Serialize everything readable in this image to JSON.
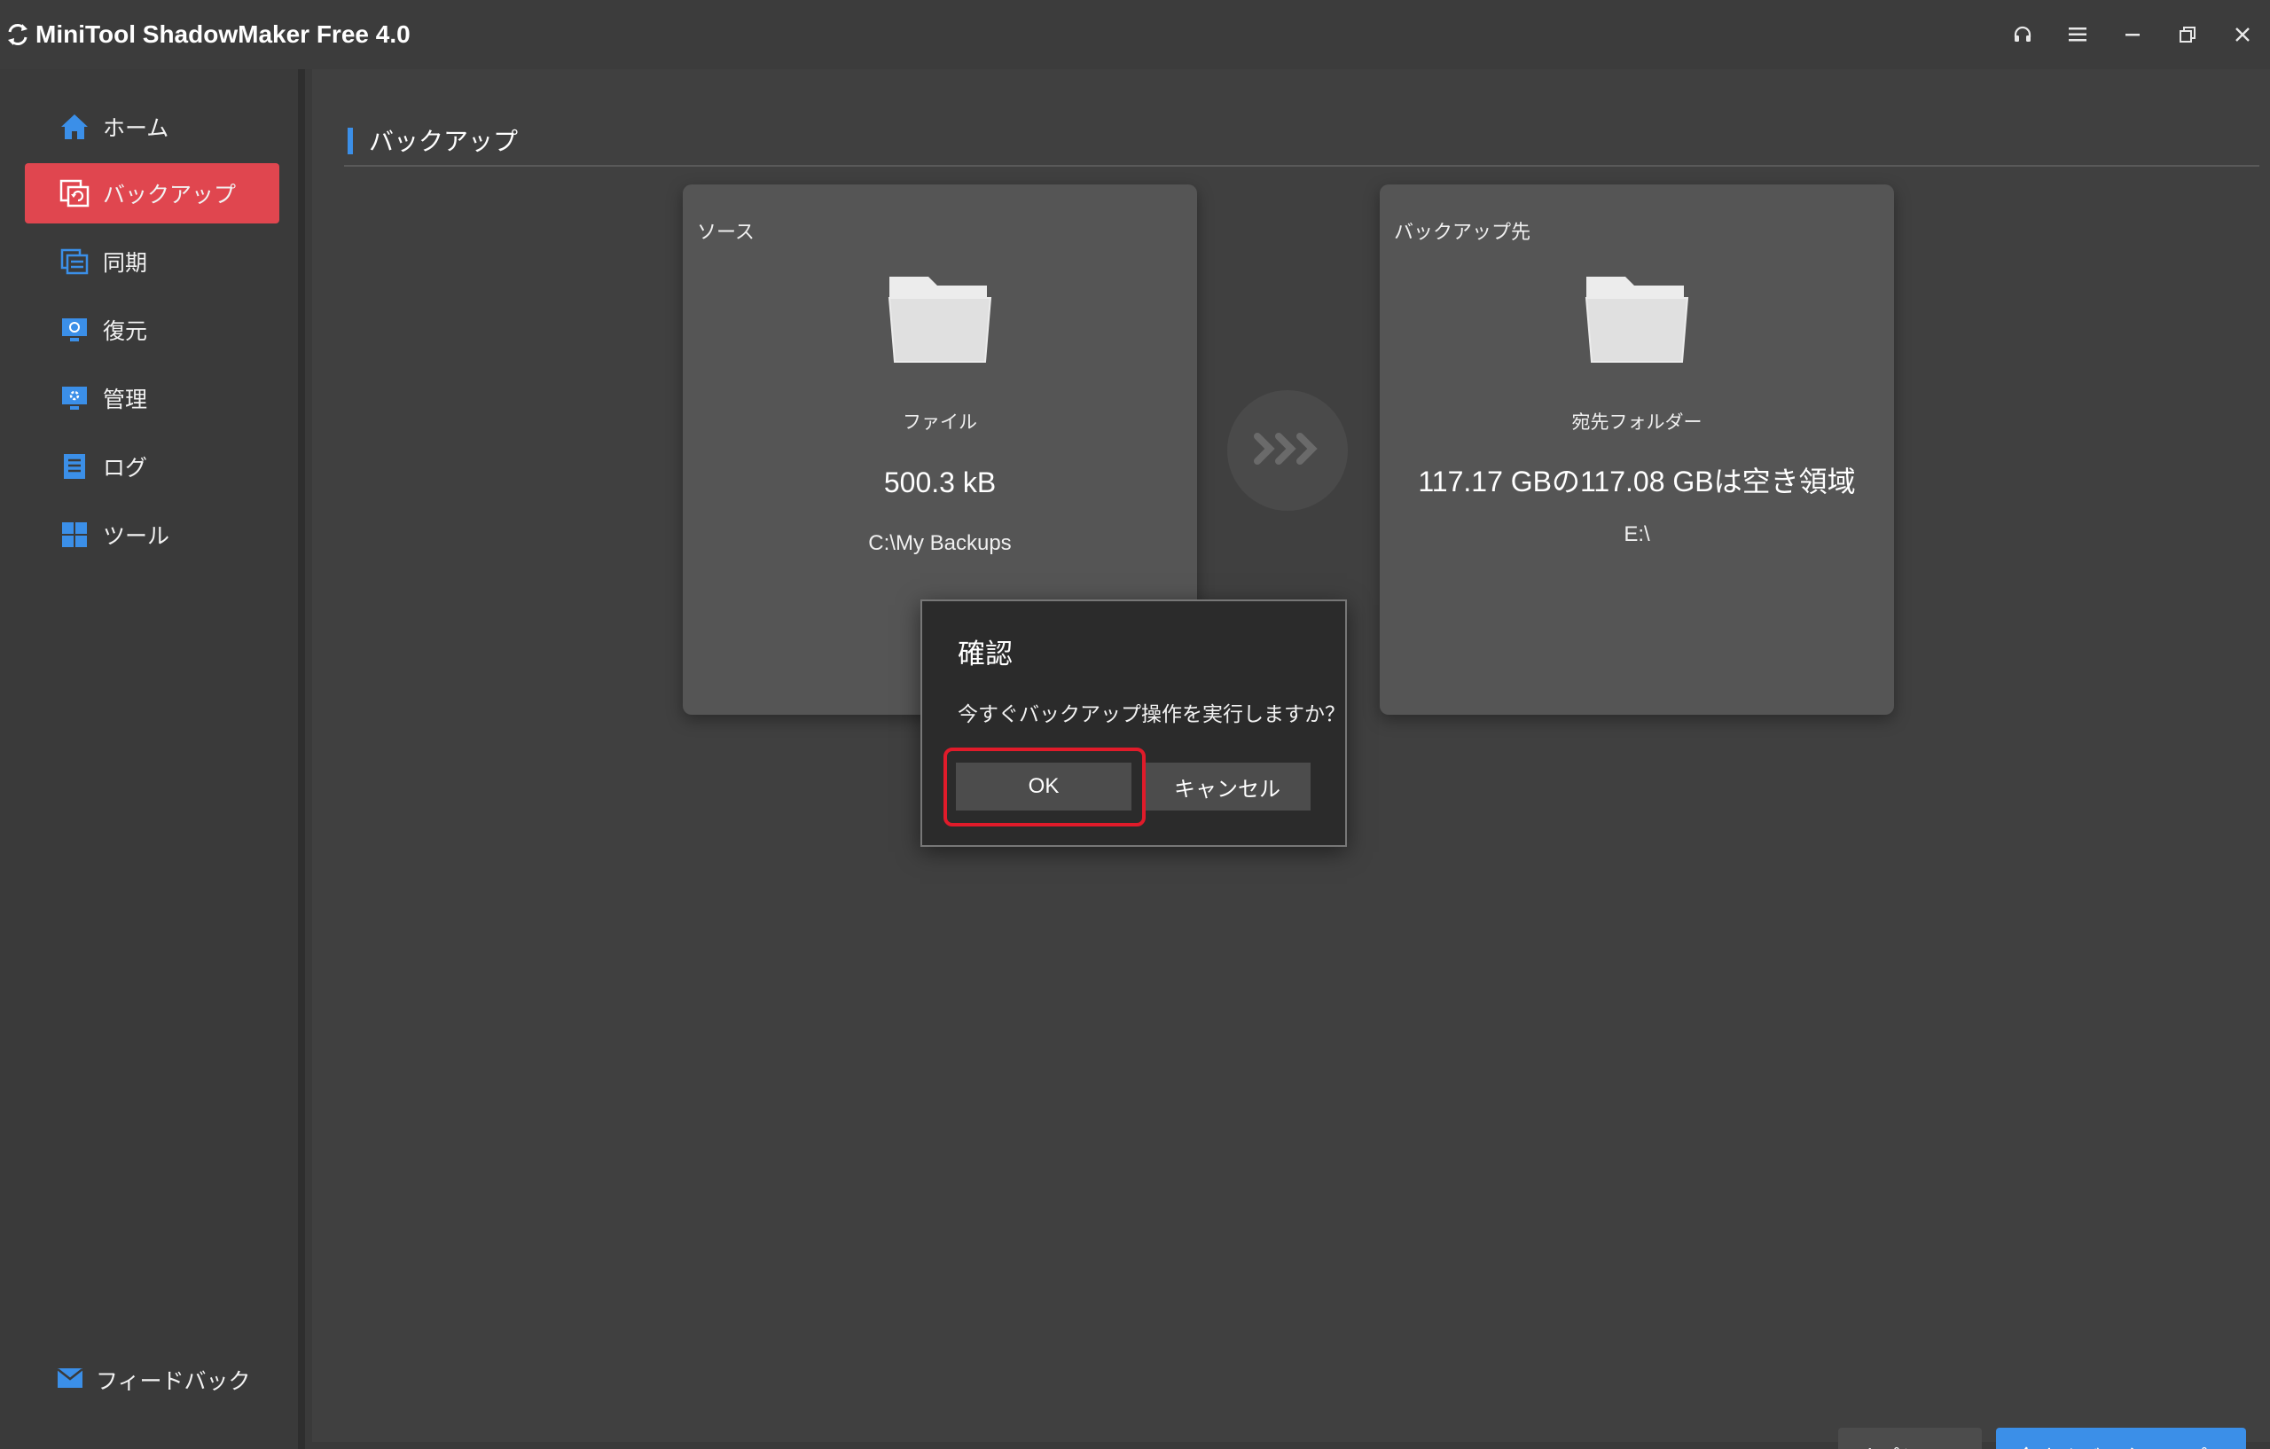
{
  "window": {
    "title": "MiniTool ShadowMaker Free 4.0",
    "controls": [
      "headset-icon",
      "menu-icon",
      "minimize-icon",
      "restore-icon",
      "close-icon"
    ]
  },
  "sidebar": {
    "items": [
      {
        "label": "ホーム",
        "icon": "home-icon",
        "active": false
      },
      {
        "label": "バックアップ",
        "icon": "backup-icon",
        "active": true
      },
      {
        "label": "同期",
        "icon": "sync-icon",
        "active": false
      },
      {
        "label": "復元",
        "icon": "restore-icon",
        "active": false
      },
      {
        "label": "管理",
        "icon": "manage-icon",
        "active": false
      },
      {
        "label": "ログ",
        "icon": "log-icon",
        "active": false
      },
      {
        "label": "ツール",
        "icon": "tools-icon",
        "active": false
      }
    ],
    "feedback": {
      "label": "フィードバック",
      "icon": "mail-icon"
    }
  },
  "main": {
    "section_title": "バックアップ",
    "source": {
      "label": "ソース",
      "type": "ファイル",
      "size": "500.3 kB",
      "path": "C:\\My Backups"
    },
    "destination": {
      "label": "バックアップ先",
      "type": "宛先フォルダー",
      "size": "117.17 GBの117.08 GBは空き領域",
      "path": "E:\\"
    }
  },
  "dialog": {
    "title": "確認",
    "message": "今すぐバックアップ操作を実行しますか？",
    "ok_label": "OK",
    "cancel_label": "キャンセル"
  },
  "footer": {
    "options_label": "オプション",
    "backup_now_label": "今すぐバックアップ",
    "dropdown_glyph": "▼"
  },
  "colors": {
    "accent_red": "#e0464f",
    "accent_blue": "#3b8fe8",
    "highlight_red": "#e01b2a"
  }
}
